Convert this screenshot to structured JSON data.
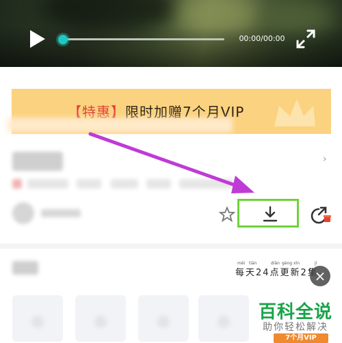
{
  "video": {
    "time_display": "00:00/00:00",
    "progress": 0.0,
    "accent_color": "#1fc8c0"
  },
  "promo_banner": {
    "bracket_text": "【特惠】",
    "main_text": "限时加赠7个月VIP",
    "background_color": "#fbd27f"
  },
  "actions": {
    "download_icon": "download-icon",
    "share_icon": "share-icon",
    "highlight_color": "#6fd13b"
  },
  "episodes_header": {
    "update_text": "每天24点更新2集",
    "pinyin": [
      "měi",
      "tiān",
      "diǎn",
      "gèng",
      "xīn",
      "jí"
    ]
  },
  "annotation": {
    "arrow_color": "#c03ad6"
  },
  "watermark": {
    "title": "百科全说",
    "subtitle": "助你轻松解决",
    "badge": "7个月VIP"
  }
}
